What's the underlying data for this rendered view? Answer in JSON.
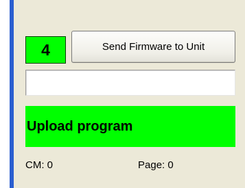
{
  "step": {
    "number": "4",
    "color": "#00ff00"
  },
  "toolbar": {
    "send_firmware_label": "Send Firmware to Unit"
  },
  "progress": {
    "value": 0
  },
  "status": {
    "text": "Upload program",
    "color": "#00ff00"
  },
  "counters": {
    "cm": "CM: 0",
    "page": "Page: 0"
  },
  "colors": {
    "panel_background": "#ece9d8",
    "accent_rail": "#2b5fd0"
  }
}
